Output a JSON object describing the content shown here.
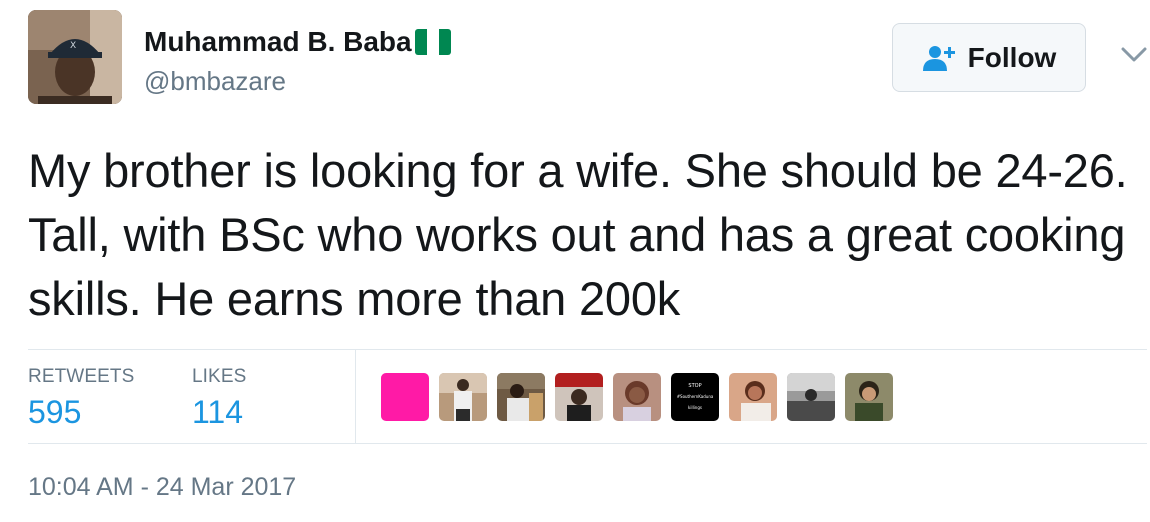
{
  "author": {
    "display_name": "Muhammad B. Baba",
    "handle": "@bmbazare",
    "flag_green": "#008751"
  },
  "follow_button": {
    "label": "Follow"
  },
  "tweet": {
    "text": "My brother is looking for a wife. She should be 24-26. Tall, with BSc who works out and has a great cooking skills. He earns more than 200k"
  },
  "stats": {
    "retweets_label": "RETWEETS",
    "retweets_value": "595",
    "likes_label": "LIKES",
    "likes_value": "114"
  },
  "likers": [
    {
      "icon": "pink-avatar",
      "color": "#ff1aa6"
    },
    {
      "icon": "person-photo-avatar",
      "color": "#8a6a4f"
    },
    {
      "icon": "person-photo-avatar",
      "color": "#5c4632"
    },
    {
      "icon": "person-photo-avatar",
      "color": "#b7a79a"
    },
    {
      "icon": "person-photo-avatar",
      "color": "#a3887a"
    },
    {
      "icon": "text-avatar",
      "color": "#000000"
    },
    {
      "icon": "person-photo-avatar",
      "color": "#c07a5c"
    },
    {
      "icon": "bw-photo-avatar",
      "color": "#6d6d6d"
    },
    {
      "icon": "person-photo-avatar",
      "color": "#6b5e3c"
    }
  ],
  "likers_text_avatar": {
    "line1": "STOP",
    "line2": "#SouthernKaduna",
    "line3": "killings"
  },
  "timestamp": "10:04 AM - 24 Mar 2017",
  "colors": {
    "link_blue": "#1b95e0",
    "muted_gray": "#657786",
    "text_dark": "#14171a"
  }
}
